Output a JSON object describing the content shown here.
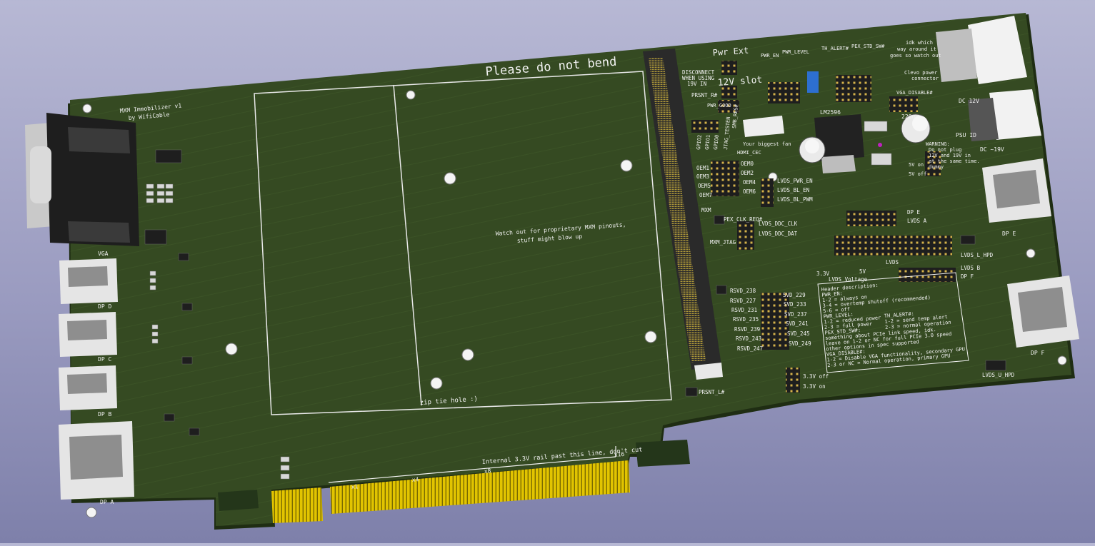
{
  "board": {
    "title": "MXM Immobilizer v1",
    "author": "by WifiCable",
    "warning_bend": "Please do not bend",
    "mxm_note_1": "Watch out for proprietary MXM pinouts,",
    "mxm_note_2": "stuff might blow up",
    "zip_tie": "zip tie hole :)",
    "rail_note": "Internal 3.3V rail past this line, don't cut",
    "lane_x1": "x1",
    "lane_x4": "x4",
    "lane_x8": "x8",
    "lane_x16": "x16",
    "disconnect_1": "DISCONNECT",
    "disconnect_2": "WHEN USING",
    "disconnect_3": "19V IN",
    "pwr_ext": "Pwr Ext",
    "slot_12v": "12V slot",
    "lm_part": "LM2596",
    "cap_220": "220u",
    "psu_id": "PSU ID",
    "dc_12v": "DC 12V",
    "dc_19v": "DC ~19V",
    "clevo_1": "idk which",
    "clevo_2": "way around it",
    "clevo_3": "goes so watch out",
    "clevo_4": "Clevo power",
    "clevo_5": "connector",
    "fan_label": "Your biggest fan",
    "warn_title": "WARNING:",
    "warn_1": "Do not plug",
    "warn_2": "12V and 19V in",
    "warn_3": "at the same time.",
    "warn_4": "dummy",
    "v5_on": "5V on",
    "v5_off": "5V off",
    "v33_off": "3.3V off",
    "v33_on": "3.3V on",
    "lvds_voltage": "LVDS Voltage",
    "v33": "3.3V",
    "v_suffix": "5V",
    "lvds_label": "LVDS",
    "hdr_pwr_en": "PWR_EN",
    "hdr_pwr_level": "PWR_LEVEL",
    "hdr_th_alert": "TH_ALERT#",
    "hdr_pex_std": "PEX_STD_SW#",
    "hdr_vga_disable": "VGA_DISABLE#",
    "ports": {
      "vga": "VGA",
      "dp_d": "DP D",
      "dp_c": "DP C",
      "dp_b": "DP B",
      "dp_a": "DP A",
      "dp_e": "DP E",
      "dp_f": "DP F",
      "dp_e_arrow": "DP E",
      "dp_f_arrow": "DP F",
      "lvds_a": "LVDS A",
      "lvds_b": "LVDS B",
      "lvds_l_hpd": "LVDS_L_HPD",
      "lvds_u_hpd": "LVDS_U_HPD"
    },
    "left_signals": [
      "PRSNT_R#",
      "PWR_GOOD",
      "GPIO2",
      "GPIO1",
      "GPIO0",
      "JTAG_TESTEN",
      "SMB_RES#",
      "HDMI_CEC"
    ],
    "oem_left": [
      "OEM1",
      "OEM3",
      "OEM5",
      "OEM7"
    ],
    "oem_right": [
      "OEM0",
      "OEM2",
      "OEM4",
      "OEM6"
    ],
    "lvds_ctrl": [
      "LVDS_PWR_EN",
      "LVDS_BL_EN",
      "LVDS_BL_PWM"
    ],
    "mxm_label": "MXM",
    "pex_clk": "PEX_CLK_REQ#",
    "ddc_clk": "LVDS_DDC_CLK",
    "ddc_dat": "LVDS_DDC_DAT",
    "mxm_jtag": "MXM_JTAG",
    "rsvd_left": [
      "RSVD_238",
      "RSVD_227",
      "RSVD_231",
      "RSVD_235",
      "RSVD_239",
      "RSVD_243",
      "RSVD_247"
    ],
    "rsvd_right": [
      "SVD_229",
      "SVD_233",
      "SVD_237",
      "SVD_241",
      "SVD_245",
      "SVD_249"
    ],
    "prsnt_l": "PRSNT_L#",
    "header_desc": [
      "Header description:",
      "PWR_EN:",
      "1-2 = always on",
      "3-4 = overtemp shutoff (recommended)",
      "5-6 = off",
      "PWR_LEVEL:",
      "1-2 = reduced power",
      "2-3 = full power",
      "PEX_STD_SW#:",
      "something about PCIe link speed, idk.",
      "leave on 1-2 or NC for full PCIe 3.0 speed",
      "other options in spec supported",
      "VGA_DISABLE#:",
      "1-2 = Disable VGA functionality, secondary GPU",
      "2-3 or NC = Normal operation, primary GPU"
    ],
    "th_alert_desc": [
      "TH_ALERT#:",
      "1-2 = send temp alert",
      "2-3 = normal operation"
    ]
  },
  "colors": {
    "background": "#9c9dc2",
    "pcb": "#354a22",
    "pcb_edge": "#1e2c12",
    "silkscreen": "#f2f2f2",
    "gold": "#e2c400",
    "connector_metal": "#d9d9d9",
    "mxm_slot": "#2a2a2a"
  }
}
